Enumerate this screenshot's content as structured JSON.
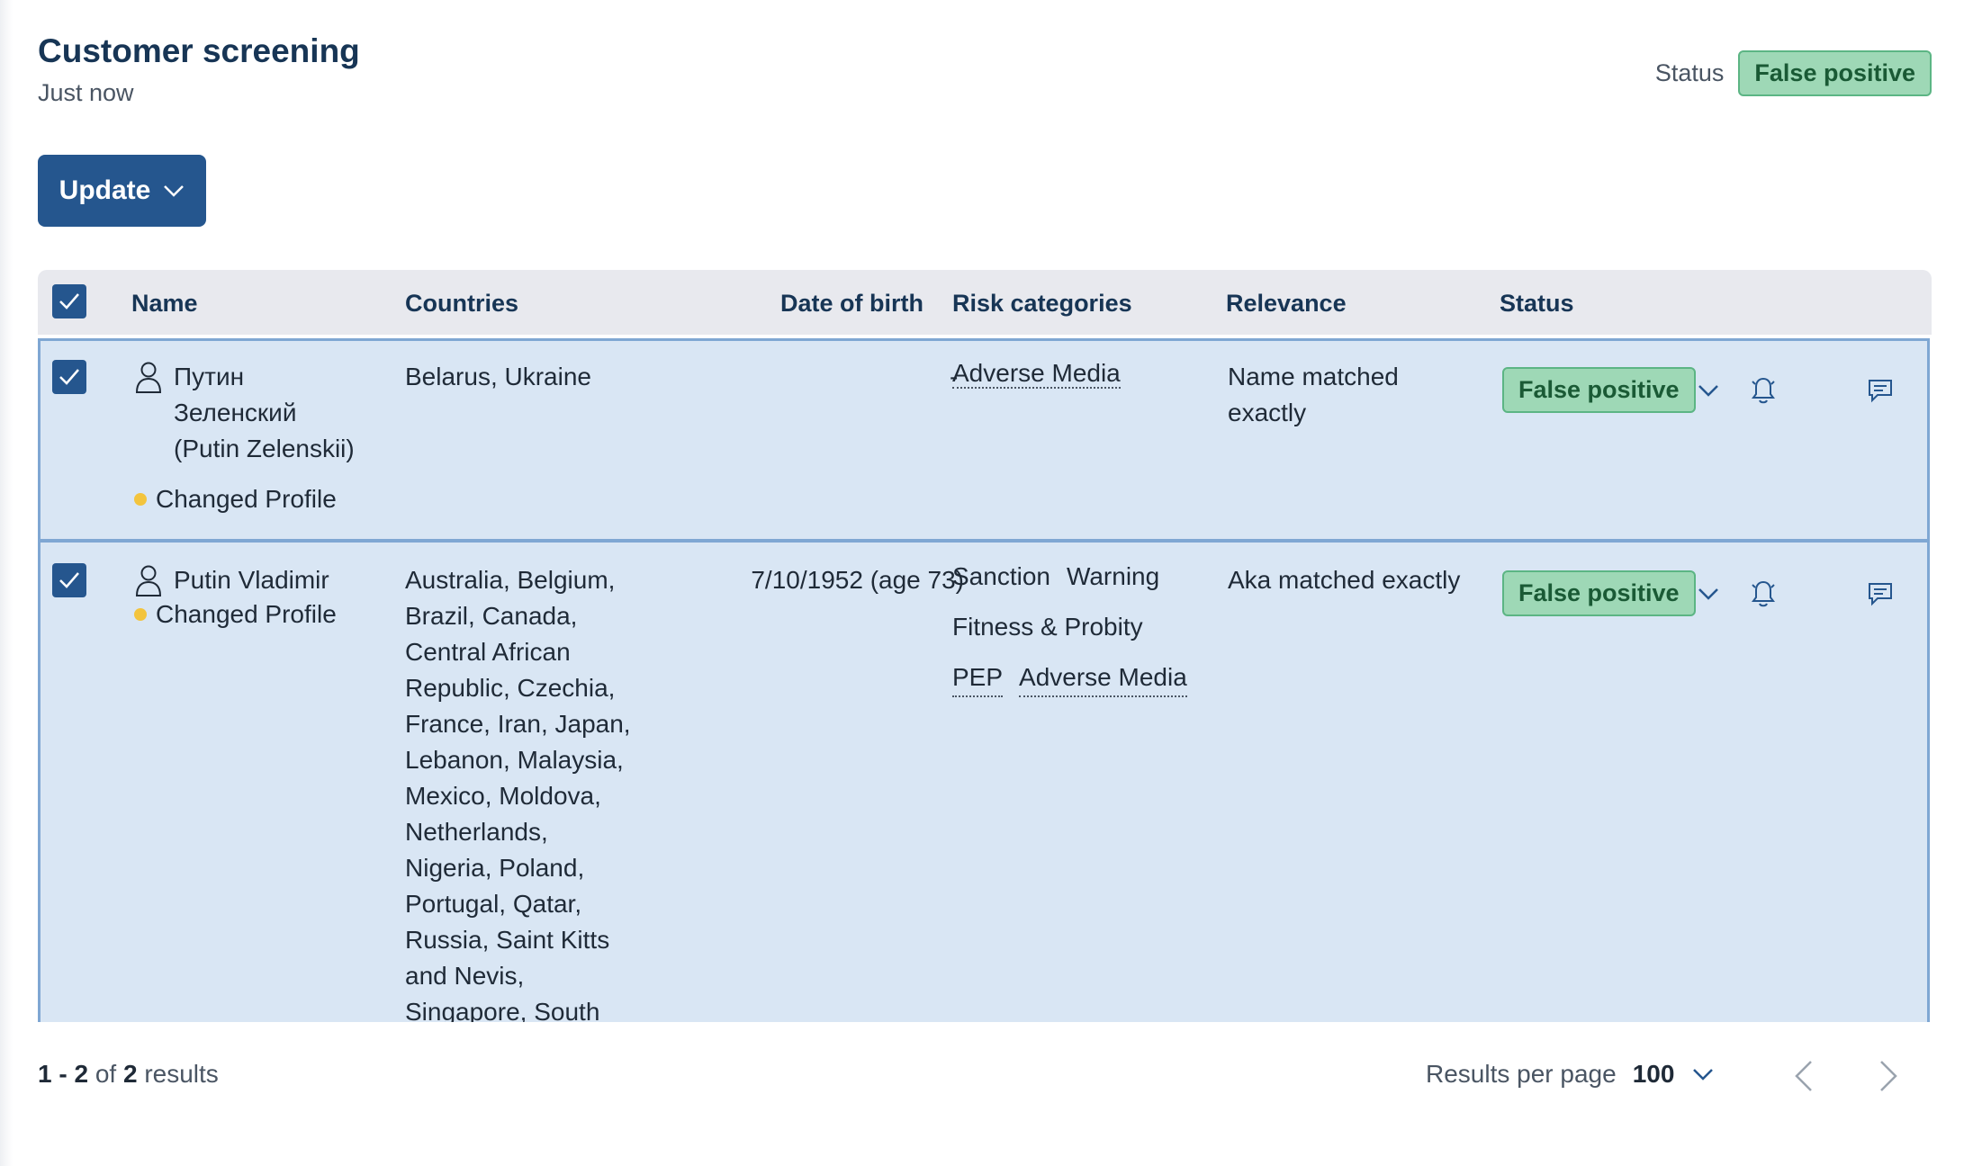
{
  "page": {
    "title": "Customer screening",
    "subtitle": "Just now",
    "status_label": "Status",
    "status_value": "False positive",
    "update_label": "Update"
  },
  "table": {
    "columns": [
      "Name",
      "Countries",
      "Date of birth",
      "Risk categories",
      "Relevance",
      "Status"
    ],
    "rows": [
      {
        "name_lines": [
          "Путин",
          "Зеленский",
          "(Putin Zelenskii)"
        ],
        "changed": "Changed Profile",
        "countries": "Belarus, Ukraine",
        "dob": "-",
        "risk_lines": [
          [
            "Adverse Media"
          ]
        ],
        "relevance_lines": [
          "Name matched",
          "exactly"
        ],
        "status": "False positive"
      },
      {
        "name_lines": [
          "Putin Vladimir"
        ],
        "changed": "Changed Profile",
        "countries_lines": [
          "Australia, Belgium,",
          "Brazil, Canada,",
          "Central African",
          "Republic, Czechia,",
          "France, Iran, Japan,",
          "Lebanon, Malaysia,",
          "Mexico, Moldova,",
          "Netherlands,",
          "Nigeria, Poland,",
          "Portugal, Qatar,",
          "Russia, Saint Kitts",
          "and Nevis,",
          "Singapore, South"
        ],
        "dob": "7/10/1952 (age 73)",
        "risk_lines": [
          [
            "Sanction",
            "Warning"
          ],
          [
            "Fitness & Probity"
          ],
          [
            "PEP",
            "Adverse Media"
          ]
        ],
        "relevance_lines": [
          "Aka matched exactly"
        ],
        "status": "False positive"
      }
    ]
  },
  "footer": {
    "range": "1 - 2",
    "of": "of",
    "total": "2",
    "results_word": "results",
    "rpp_label": "Results per page",
    "rpp_value": "100"
  }
}
